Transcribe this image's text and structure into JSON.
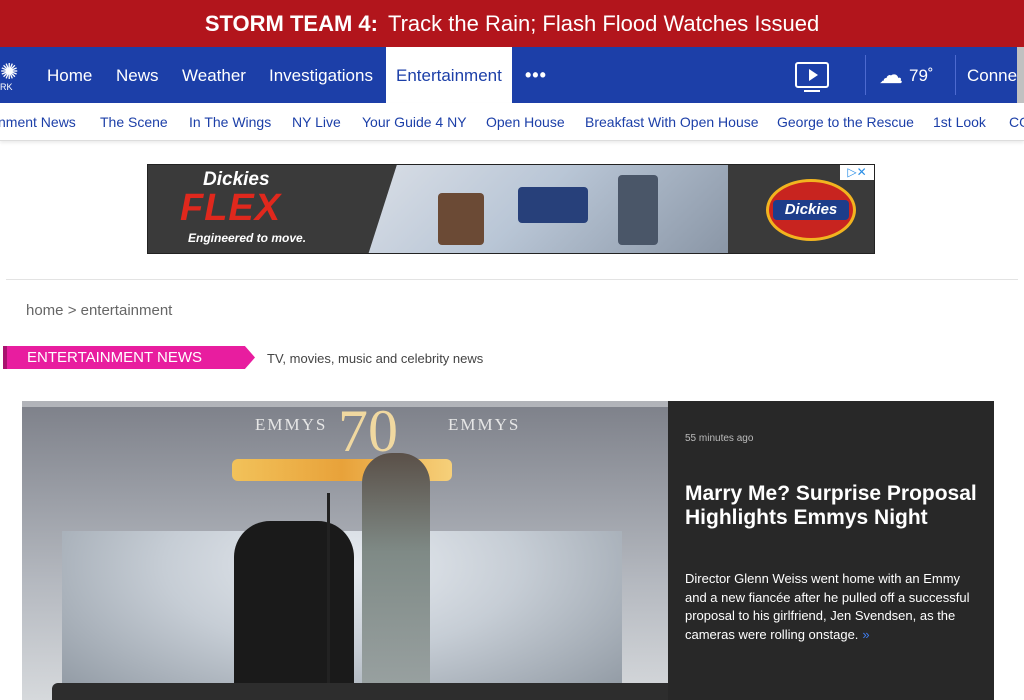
{
  "alert": {
    "label": "STORM TEAM 4:",
    "text": "Track the Rain; Flash Flood Watches Issued"
  },
  "nav": {
    "logo_text": "RK",
    "items": [
      "Home",
      "News",
      "Weather",
      "Investigations",
      "Entertainment"
    ],
    "more": "•••",
    "temperature": "79˚",
    "connect": "Connect"
  },
  "subnav": {
    "items": [
      "nment News",
      "The Scene",
      "In The Wings",
      "NY Live",
      "Your Guide 4 NY",
      "Open House",
      "Breakfast With Open House",
      "George to the Rescue",
      "1st Look",
      "CO"
    ]
  },
  "ad": {
    "brand": "Dickies",
    "headline": "FLEX",
    "tagline": "Engineered to move.",
    "badge": "Dickies"
  },
  "breadcrumb": "home > entertainment",
  "section": {
    "title": "ENTERTAINMENT NEWS",
    "description": "TV, movies, music and celebrity news"
  },
  "hero": {
    "emmys_left": "EMMYS",
    "emmys_right": "EMMYS",
    "seventy": "70",
    "time": "55 minutes ago",
    "title": "Marry Me? Surprise Proposal Highlights Emmys Night",
    "body": "Director Glenn Weiss went home with an Emmy and a new fiancée after he pulled off a successful proposal to his girlfriend, Jen Svendsen, as the cameras were rolling onstage.",
    "more": "»"
  },
  "colors": {
    "alert": "#b2151c",
    "nav": "#1c3fa8",
    "section_tag": "#e81d9f",
    "hero_panel": "#282828"
  }
}
